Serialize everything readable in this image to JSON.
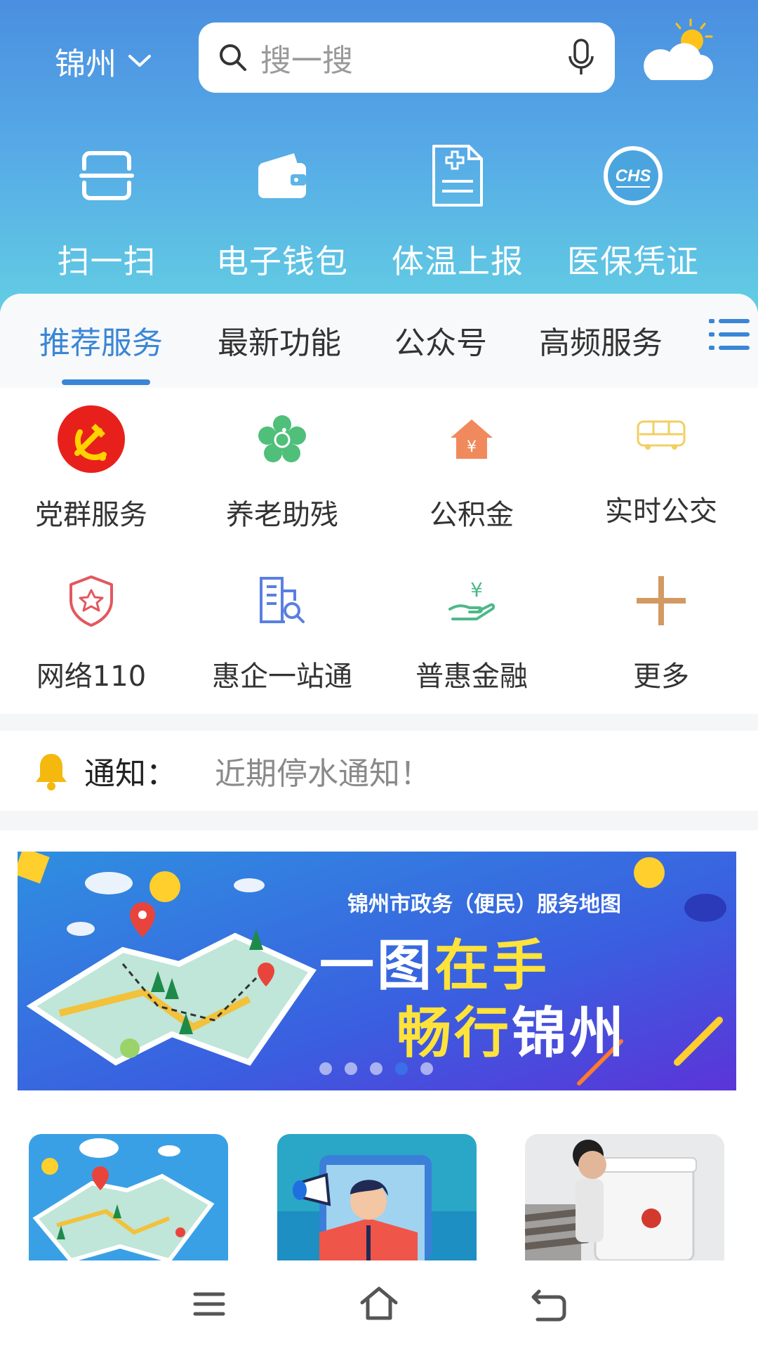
{
  "header": {
    "city": "锦州",
    "search_placeholder": "搜一搜",
    "quick_actions": [
      {
        "label": "扫一扫",
        "icon": "scan-icon"
      },
      {
        "label": "电子钱包",
        "icon": "wallet-icon"
      },
      {
        "label": "体温上报",
        "icon": "health-report-icon"
      },
      {
        "label": "医保凭证",
        "icon": "chs-medical-insurance-icon"
      }
    ],
    "weather_icon": "partly-cloudy-icon"
  },
  "tabs": {
    "items": [
      {
        "label": "推荐服务",
        "active": true
      },
      {
        "label": "最新功能",
        "active": false
      },
      {
        "label": "公众号",
        "active": false
      },
      {
        "label": "高频服务",
        "active": false
      }
    ],
    "menu_icon": "list-menu-icon"
  },
  "services": [
    {
      "label": "党群服务",
      "icon": "party-emblem-icon"
    },
    {
      "label": "养老助残",
      "icon": "elderly-disabled-icon"
    },
    {
      "label": "公积金",
      "icon": "housing-fund-icon"
    },
    {
      "label": "实时公交",
      "icon": "bus-icon"
    },
    {
      "label": "网络110",
      "icon": "police-shield-icon"
    },
    {
      "label": "惠企一站通",
      "icon": "enterprise-search-icon"
    },
    {
      "label": "普惠金融",
      "icon": "finance-hand-icon"
    },
    {
      "label": "更多",
      "icon": "plus-icon"
    }
  ],
  "notice": {
    "label": "通知：",
    "text": "近期停水通知！"
  },
  "banner": {
    "subtitle": "锦州市政务（便民）服务地图",
    "title_line1_a": "一图",
    "title_line1_b": "在手",
    "title_line2_a": "畅行",
    "title_line2_b": "锦州",
    "dot_count": 5,
    "active_dot": 3
  },
  "colors": {
    "accent": "#3a86d6",
    "header_top": "#4a8fe0",
    "header_bottom": "#63d0e3",
    "party_red": "#e8201c",
    "notice_yellow": "#f5b80f"
  },
  "navbar": {
    "icons": [
      "menu-icon",
      "home-icon",
      "back-icon"
    ]
  }
}
